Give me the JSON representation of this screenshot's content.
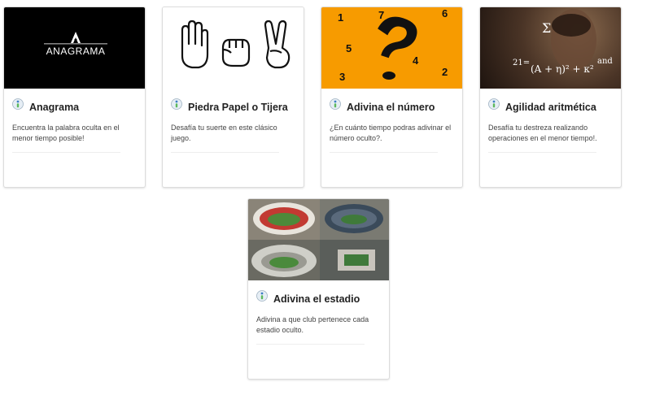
{
  "cards": [
    {
      "title": "Anagrama",
      "description": "Encuentra la palabra oculta en el menor tiempo posible!",
      "image_text": "ANAGRAMA"
    },
    {
      "title": "Piedra Papel o Tijera",
      "description": "Desafía tu suerte en este clásico juego."
    },
    {
      "title": "Adivina el número",
      "description": "¿En cuánto tiempo podras adivinar el número oculto?.",
      "image_digits": [
        "1",
        "7",
        "6",
        "5",
        "4",
        "3",
        "2"
      ]
    },
    {
      "title": "Agilidad aritmética",
      "description": "Desafía tu destreza realizando operaciones en el menor tiempo!.",
      "image_formula": [
        "21=",
        "(A + η)² + κ²",
        "and",
        "Σ"
      ]
    },
    {
      "title": "Adivina el estadio",
      "description": "Adivina a que club pertenece cada estadio oculto."
    }
  ],
  "colors": {
    "numero_bg": "#f79b00",
    "info_icon_blue": "#3d7ec4",
    "info_icon_green": "#5cb85c"
  },
  "icons": [
    "info-icon",
    "hand-rock-icon",
    "hand-paper-icon",
    "hand-scissors-icon",
    "question-mark-icon",
    "anagrama-logo-icon"
  ]
}
